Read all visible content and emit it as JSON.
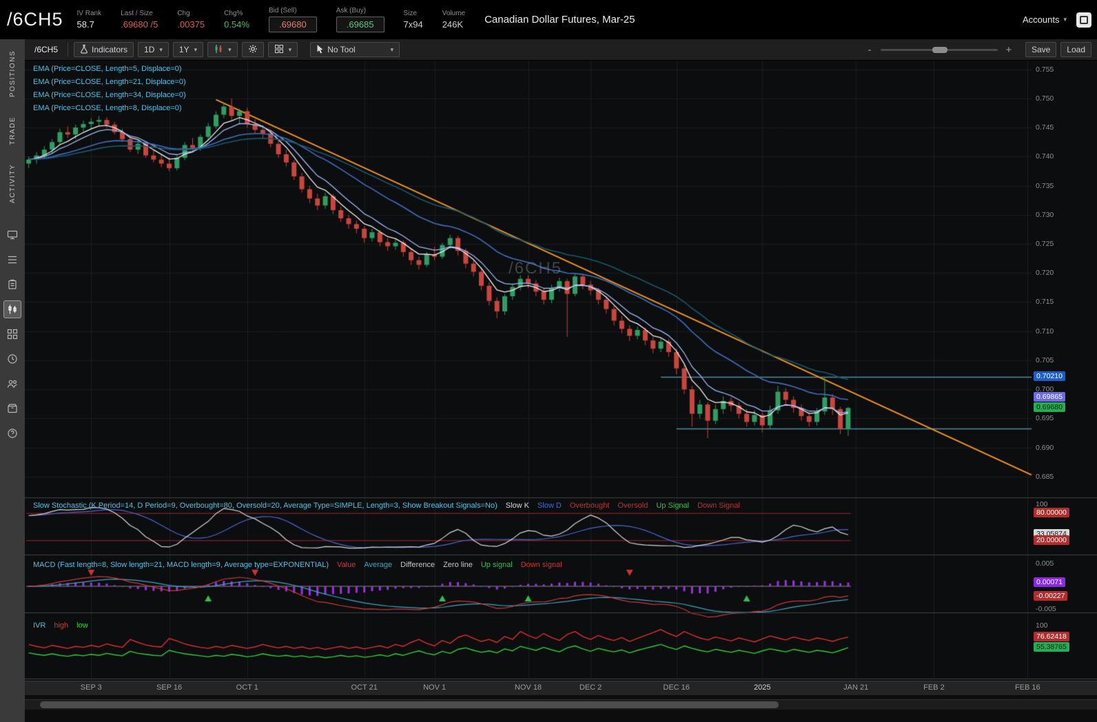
{
  "header": {
    "symbol": "/6CH5",
    "description": "Canadian Dollar Futures, Mar-25",
    "accounts_label": "Accounts",
    "fields": [
      {
        "key": "iv-rank",
        "label": "IV Rank",
        "value": "58.7",
        "color": "#e4e4e4"
      },
      {
        "key": "last-size",
        "label": "Last / Size",
        "value": ".69680 /5",
        "color": "#e05a50"
      },
      {
        "key": "chg",
        "label": "Chg",
        "value": ".00375",
        "color": "#e05a50"
      },
      {
        "key": "chg-pct",
        "label": "Chg%",
        "value": "0.54%",
        "color": "#3dbf5f"
      },
      {
        "key": "bid",
        "label": "Bid (Sell)",
        "value": ".69680",
        "color": "#e87a6e",
        "boxed": true
      },
      {
        "key": "ask",
        "label": "Ask (Buy)",
        "value": ".69685",
        "color": "#58c97f",
        "boxed": true
      },
      {
        "key": "size",
        "label": "Size",
        "value": "7x94",
        "color": "#cfcfcf"
      },
      {
        "key": "volume",
        "label": "Volume",
        "value": "246K",
        "color": "#cfcfcf"
      }
    ]
  },
  "sidebar": {
    "tabs": [
      {
        "label": "POSITIONS"
      },
      {
        "label": "TRADE"
      },
      {
        "label": "ACTIVITY"
      }
    ],
    "icons": [
      {
        "name": "monitor-icon",
        "glyph": "monitor"
      },
      {
        "name": "watchlist-icon",
        "glyph": "list"
      },
      {
        "name": "orders-icon",
        "glyph": "clipboard"
      },
      {
        "name": "chart-icon",
        "glyph": "candles",
        "active": true
      },
      {
        "name": "grid-layout-icon",
        "glyph": "grid"
      },
      {
        "name": "history-icon",
        "glyph": "clock"
      },
      {
        "name": "community-icon",
        "glyph": "people"
      },
      {
        "name": "products-icon",
        "glyph": "box"
      },
      {
        "name": "help-icon",
        "glyph": "help"
      }
    ]
  },
  "toolbar": {
    "symbol_t0b": "",
    "symbol_tab": "/6CH5",
    "indicators_label": "Indicators",
    "timeframe": "1D",
    "range": "1Y",
    "tool_label": "No Tool",
    "zoom_minus": "-",
    "zoom_plus": "+",
    "save_label": "Save",
    "load_label": "Load"
  },
  "palette": {
    "bg": "#0c0d0e",
    "grid": "#1a1d20",
    "divider": "#3d4147",
    "candle_up": "#2f9e63",
    "candle_down": "#c9463d",
    "trendline": "#f0941e",
    "hline": "#4d8fa6",
    "stoch_k": "#d8d8d8",
    "stoch_d": "#4a68d8",
    "stoch_level": "#9e2b2b",
    "macd_value": "#d03838",
    "macd_avg": "#38a8c8",
    "macd_hist": "#9b30e8",
    "macd_zero": "#8a8a8a",
    "signal_up": "#2fbf4f",
    "signal_down": "#d03030",
    "ivr_high": "#e03030",
    "ivr_low": "#30d030",
    "ema_colors": [
      "#f2f2f2",
      "#9fb8f8",
      "#3f6fc0",
      "#17596e"
    ]
  },
  "chart": {
    "watermark": "/6CH5",
    "main_studies": [
      "EMA (Price=CLOSE, Length=5, Displace=0)",
      "EMA (Price=CLOSE, Length=21, Displace=0)",
      "EMA (Price=CLOSE, Length=34, Displace=0)",
      "EMA (Price=CLOSE, Length=8, Displace=0)"
    ],
    "ema_lengths": [
      5,
      8,
      21,
      34
    ],
    "total_days": 129,
    "price_axis": {
      "ticks": [
        "0.755",
        "0.750",
        "0.745",
        "0.740",
        "0.735",
        "0.730",
        "0.725",
        "0.720",
        "0.715",
        "0.710",
        "0.705",
        "0.700",
        "0.695",
        "0.690",
        "0.685"
      ],
      "bubbles": [
        {
          "text": "0.70210",
          "value": 0.7021,
          "bg": "#1d5ecb",
          "fg": "#ffffff"
        },
        {
          "text": "0.69865",
          "value": 0.69865,
          "bg": "#6b6be4",
          "fg": "#ffffff"
        },
        {
          "text": "0.69680",
          "value": 0.6968,
          "bg": "#27ab54",
          "fg": "#06230f"
        }
      ]
    },
    "trendline": {
      "from_day": 24,
      "from_price": 0.7498,
      "to_day": 128.5,
      "to_price": 0.6853
    },
    "hlines": [
      {
        "price": 0.7021,
        "from_day": 81
      },
      {
        "price": 0.6932,
        "from_day": 83
      }
    ],
    "time_axis": [
      {
        "text": "SEP 3",
        "day": 8
      },
      {
        "text": "SEP 16",
        "day": 18
      },
      {
        "text": "OCT 1",
        "day": 28
      },
      {
        "text": "OCT 21",
        "day": 43
      },
      {
        "text": "NOV 1",
        "day": 52
      },
      {
        "text": "NOV 18",
        "day": 64
      },
      {
        "text": "DEC 2",
        "day": 72
      },
      {
        "text": "DEC 16",
        "day": 83
      },
      {
        "text": "2025",
        "day": 94,
        "strong": true
      },
      {
        "text": "JAN 21",
        "day": 106
      },
      {
        "text": "FEB 2",
        "day": 116
      },
      {
        "text": "FEB 16",
        "day": 128
      }
    ],
    "candles": [
      [
        0.7388,
        0.74,
        0.738,
        0.7395
      ],
      [
        0.7395,
        0.7408,
        0.7388,
        0.7402
      ],
      [
        0.7402,
        0.7418,
        0.7396,
        0.7412
      ],
      [
        0.7412,
        0.743,
        0.7406,
        0.7425
      ],
      [
        0.7425,
        0.7448,
        0.742,
        0.7442
      ],
      [
        0.7442,
        0.7452,
        0.7432,
        0.7438
      ],
      [
        0.7438,
        0.7455,
        0.743,
        0.745
      ],
      [
        0.745,
        0.7462,
        0.7443,
        0.7456
      ],
      [
        0.7456,
        0.7466,
        0.7448,
        0.746
      ],
      [
        0.746,
        0.747,
        0.7452,
        0.7463
      ],
      [
        0.7463,
        0.7468,
        0.745,
        0.7455
      ],
      [
        0.7455,
        0.746,
        0.7438,
        0.7442
      ],
      [
        0.7442,
        0.7448,
        0.7425,
        0.743
      ],
      [
        0.743,
        0.7436,
        0.7408,
        0.7412
      ],
      [
        0.7412,
        0.7428,
        0.7405,
        0.7422
      ],
      [
        0.7422,
        0.7426,
        0.7398,
        0.7402
      ],
      [
        0.7402,
        0.7412,
        0.739,
        0.7395
      ],
      [
        0.7395,
        0.7404,
        0.7382,
        0.7388
      ],
      [
        0.7388,
        0.7398,
        0.7375,
        0.738
      ],
      [
        0.738,
        0.7402,
        0.7376,
        0.7398
      ],
      [
        0.7398,
        0.7425,
        0.7394,
        0.742
      ],
      [
        0.742,
        0.7432,
        0.7408,
        0.7415
      ],
      [
        0.7415,
        0.7438,
        0.741,
        0.7434
      ],
      [
        0.7434,
        0.7458,
        0.7428,
        0.7452
      ],
      [
        0.7452,
        0.7478,
        0.7448,
        0.7472
      ],
      [
        0.7472,
        0.7492,
        0.7466,
        0.7486
      ],
      [
        0.7486,
        0.75,
        0.7462,
        0.747
      ],
      [
        0.747,
        0.7482,
        0.7455,
        0.7478
      ],
      [
        0.7478,
        0.7484,
        0.745,
        0.7456
      ],
      [
        0.7456,
        0.7464,
        0.744,
        0.7446
      ],
      [
        0.7446,
        0.7454,
        0.7432,
        0.744
      ],
      [
        0.744,
        0.7446,
        0.7416,
        0.7422
      ],
      [
        0.7422,
        0.7428,
        0.7398,
        0.7404
      ],
      [
        0.7404,
        0.7412,
        0.7383,
        0.739
      ],
      [
        0.739,
        0.7394,
        0.736,
        0.7366
      ],
      [
        0.7366,
        0.7372,
        0.7338,
        0.7344
      ],
      [
        0.7344,
        0.735,
        0.732,
        0.7328
      ],
      [
        0.7328,
        0.7336,
        0.7308,
        0.7316
      ],
      [
        0.7316,
        0.7338,
        0.731,
        0.7332
      ],
      [
        0.7332,
        0.7336,
        0.7301,
        0.7308
      ],
      [
        0.7308,
        0.7314,
        0.7288,
        0.7294
      ],
      [
        0.7294,
        0.73,
        0.7276,
        0.7284
      ],
      [
        0.7284,
        0.729,
        0.7268,
        0.7276
      ],
      [
        0.7276,
        0.728,
        0.7252,
        0.726
      ],
      [
        0.726,
        0.7276,
        0.7254,
        0.727
      ],
      [
        0.727,
        0.7274,
        0.7246,
        0.7253
      ],
      [
        0.7253,
        0.726,
        0.7238,
        0.7246
      ],
      [
        0.7246,
        0.7258,
        0.724,
        0.7252
      ],
      [
        0.7252,
        0.7256,
        0.7228,
        0.7236
      ],
      [
        0.7236,
        0.7242,
        0.7214,
        0.7222
      ],
      [
        0.7222,
        0.7228,
        0.7206,
        0.7214
      ],
      [
        0.7214,
        0.7236,
        0.721,
        0.7232
      ],
      [
        0.7232,
        0.7245,
        0.7222,
        0.7228
      ],
      [
        0.7228,
        0.7252,
        0.7224,
        0.7248
      ],
      [
        0.7248,
        0.7266,
        0.7242,
        0.726
      ],
      [
        0.726,
        0.7264,
        0.723,
        0.7238
      ],
      [
        0.7238,
        0.7242,
        0.7208,
        0.7216
      ],
      [
        0.7216,
        0.7222,
        0.7194,
        0.7202
      ],
      [
        0.7202,
        0.7208,
        0.717,
        0.7178
      ],
      [
        0.7178,
        0.7184,
        0.7144,
        0.7152
      ],
      [
        0.7152,
        0.7158,
        0.7122,
        0.7134
      ],
      [
        0.7134,
        0.7164,
        0.7128,
        0.716
      ],
      [
        0.716,
        0.7182,
        0.7154,
        0.7176
      ],
      [
        0.7176,
        0.7196,
        0.717,
        0.719
      ],
      [
        0.719,
        0.7196,
        0.7174,
        0.7182
      ],
      [
        0.7182,
        0.7188,
        0.716,
        0.7168
      ],
      [
        0.7168,
        0.7174,
        0.7146,
        0.7154
      ],
      [
        0.7154,
        0.718,
        0.7148,
        0.7174
      ],
      [
        0.7174,
        0.7192,
        0.7168,
        0.7186
      ],
      [
        0.7186,
        0.719,
        0.709,
        0.7164
      ],
      [
        0.7164,
        0.7198,
        0.716,
        0.7194
      ],
      [
        0.7194,
        0.7198,
        0.7172,
        0.718
      ],
      [
        0.718,
        0.7186,
        0.7162,
        0.717
      ],
      [
        0.717,
        0.7174,
        0.7146,
        0.7154
      ],
      [
        0.7154,
        0.716,
        0.713,
        0.7138
      ],
      [
        0.7138,
        0.7144,
        0.711,
        0.7118
      ],
      [
        0.7118,
        0.7126,
        0.7096,
        0.7104
      ],
      [
        0.7104,
        0.711,
        0.7083,
        0.7092
      ],
      [
        0.7092,
        0.7108,
        0.7086,
        0.7102
      ],
      [
        0.7102,
        0.7106,
        0.7076,
        0.7084
      ],
      [
        0.7084,
        0.709,
        0.7062,
        0.707
      ],
      [
        0.707,
        0.7088,
        0.7064,
        0.7082
      ],
      [
        0.7082,
        0.7086,
        0.7056,
        0.7064
      ],
      [
        0.7064,
        0.707,
        0.7026,
        0.7036
      ],
      [
        0.7036,
        0.7042,
        0.6992,
        0.7
      ],
      [
        0.7,
        0.7006,
        0.6936,
        0.6958
      ],
      [
        0.6958,
        0.6982,
        0.695,
        0.6974
      ],
      [
        0.6974,
        0.6978,
        0.6916,
        0.6946
      ],
      [
        0.6946,
        0.6974,
        0.694,
        0.6966
      ],
      [
        0.6966,
        0.6988,
        0.6958,
        0.698
      ],
      [
        0.698,
        0.6986,
        0.6962,
        0.6972
      ],
      [
        0.6972,
        0.6978,
        0.695,
        0.6958
      ],
      [
        0.6958,
        0.6966,
        0.6936,
        0.6944
      ],
      [
        0.6944,
        0.6964,
        0.6938,
        0.6956
      ],
      [
        0.6956,
        0.696,
        0.6926,
        0.6938
      ],
      [
        0.6938,
        0.6972,
        0.6932,
        0.6964
      ],
      [
        0.6964,
        0.7006,
        0.6958,
        0.6996
      ],
      [
        0.6996,
        0.7002,
        0.6974,
        0.6982
      ],
      [
        0.6982,
        0.6988,
        0.696,
        0.6968
      ],
      [
        0.6968,
        0.6974,
        0.6946,
        0.6954
      ],
      [
        0.6954,
        0.696,
        0.6936,
        0.6944
      ],
      [
        0.6944,
        0.6968,
        0.6938,
        0.6962
      ],
      [
        0.6962,
        0.7021,
        0.6956,
        0.6986
      ],
      [
        0.6986,
        0.6992,
        0.6956,
        0.6966
      ],
      [
        0.6966,
        0.697,
        0.6923,
        0.6932
      ],
      [
        0.6932,
        0.697,
        0.692,
        0.6968
      ]
    ]
  },
  "stoch": {
    "label_segments": [
      {
        "text": "Slow Stochastic (K Period=14, D Period=9, Overbought=80, Oversold=20, Average Type=SIMPLE, Length=3, Show Breakout Signals=No)",
        "color": "#4ac3e8"
      },
      {
        "text": "Slow K",
        "color": "#d8d8d8"
      },
      {
        "text": "Slow D",
        "color": "#4a68d8"
      },
      {
        "text": "Overbought",
        "color": "#c03030"
      },
      {
        "text": "Oversold",
        "color": "#c03030"
      },
      {
        "text": "Up Signal",
        "color": "#2fbf4f"
      },
      {
        "text": "Down Signal",
        "color": "#c03030"
      }
    ],
    "overbought": 80,
    "oversold": 20,
    "axis": {
      "ticks": [
        {
          "text": "100",
          "value": 100
        }
      ],
      "bubbles": [
        {
          "text": "80.00000",
          "value": 80,
          "bg": "#b32d2d",
          "fg": "#ffffff"
        },
        {
          "text": "33.05874",
          "value": 33.05874,
          "bg": "#d9d9d9",
          "fg": "#1a1a1a"
        },
        {
          "text": "20.00000",
          "value": 20,
          "bg": "#b32d2d",
          "fg": "#ffffff"
        }
      ]
    }
  },
  "macd": {
    "label_segments": [
      {
        "text": "MACD (Fast length=8, Slow length=21, MACD length=9, Average type=EXPONENTIAL)",
        "color": "#4ac3e8"
      },
      {
        "text": "Value",
        "color": "#d03838"
      },
      {
        "text": "Average",
        "color": "#38a8c8"
      },
      {
        "text": "Difference",
        "color": "#c8c8c8"
      },
      {
        "text": "Zero line",
        "color": "#c8c8c8"
      },
      {
        "text": "Up signal",
        "color": "#2fbf4f"
      },
      {
        "text": "Down signal",
        "color": "#d03030"
      }
    ],
    "up_signal_days": [
      23,
      53,
      64,
      92
    ],
    "down_signal_days": [
      8,
      29,
      77
    ],
    "axis": {
      "ticks": [
        {
          "text": "0.005",
          "value": 0.005
        },
        {
          "text": "-0.005",
          "value": -0.005
        }
      ],
      "bubbles": [
        {
          "text": "0.00071",
          "value": 0.00071,
          "bg": "#8a2be2",
          "fg": "#ffffff"
        },
        {
          "text": "-0.00227",
          "value": -0.00227,
          "bg": "#b32d2d",
          "fg": "#ffffff"
        }
      ]
    }
  },
  "ivr": {
    "label_segments": [
      {
        "text": "IVR",
        "color": "#4ac3e8"
      },
      {
        "text": "high",
        "color": "#e03030"
      },
      {
        "text": "low",
        "color": "#30d030"
      }
    ],
    "high": [
      62,
      58,
      55,
      60,
      57,
      54,
      58,
      56,
      60,
      57,
      63,
      59,
      56,
      72,
      66,
      61,
      58,
      57,
      74,
      69,
      63,
      59,
      56,
      54,
      58,
      55,
      60,
      57,
      54,
      57,
      62,
      58,
      55,
      58,
      54,
      57,
      53,
      56,
      52,
      55,
      58,
      54,
      57,
      53,
      56,
      59,
      55,
      62,
      58,
      66,
      72,
      64,
      59,
      70,
      64,
      76,
      81,
      74,
      68,
      72,
      66,
      78,
      72,
      88,
      80,
      74,
      84,
      76,
      70,
      82,
      88,
      78,
      72,
      80,
      74,
      70,
      76,
      68,
      74,
      80,
      86,
      92,
      84,
      78,
      88,
      81,
      75,
      71,
      77,
      73,
      69,
      75,
      71,
      67,
      73,
      79,
      75,
      71,
      77,
      73,
      70,
      75,
      72,
      68,
      73,
      76.6
    ],
    "low": [
      45,
      42,
      40,
      43,
      40,
      38,
      41,
      39,
      42,
      40,
      44,
      41,
      39,
      48,
      44,
      42,
      40,
      39,
      50,
      46,
      43,
      41,
      39,
      37,
      40,
      38,
      42,
      40,
      37,
      39,
      43,
      40,
      38,
      40,
      37,
      39,
      36,
      38,
      35,
      37,
      40,
      37,
      39,
      36,
      38,
      41,
      38,
      43,
      40,
      45,
      49,
      44,
      41,
      48,
      44,
      52,
      55,
      50,
      46,
      49,
      45,
      53,
      49,
      58,
      54,
      50,
      56,
      51,
      47,
      55,
      59,
      53,
      48,
      54,
      50,
      47,
      51,
      45,
      50,
      54,
      58,
      62,
      56,
      52,
      59,
      54,
      50,
      47,
      52,
      49,
      46,
      50,
      47,
      44,
      49,
      53,
      50,
      47,
      52,
      49,
      46,
      50,
      48,
      45,
      50,
      55.4
    ],
    "axis": {
      "ticks": [
        {
          "text": "100",
          "value": 100
        }
      ],
      "bubbles": [
        {
          "text": "76.62418",
          "value": 76.62418,
          "bg": "#b32d2d",
          "fg": "#ffffff"
        },
        {
          "text": "55.38765",
          "value": 55.38765,
          "bg": "#27ab54",
          "fg": "#06230f"
        }
      ]
    }
  }
}
